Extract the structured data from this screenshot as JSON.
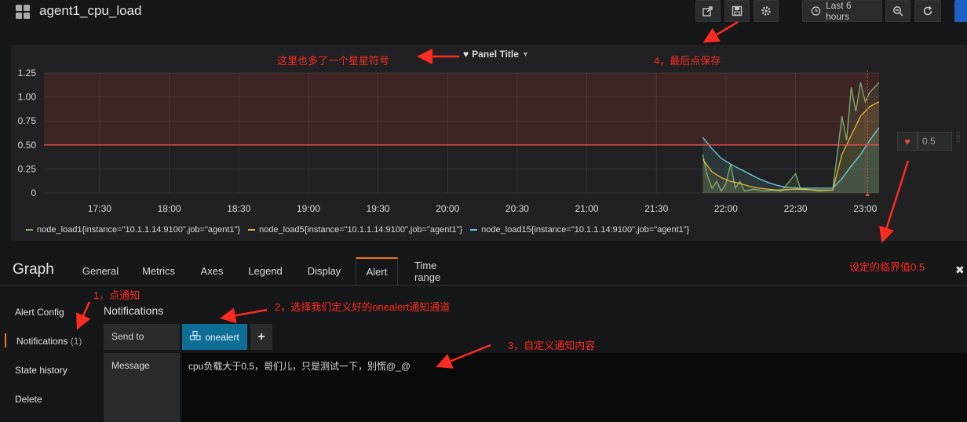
{
  "nav": {
    "dashboard_title": "agent1_cpu_load",
    "time_range_label": "Last 6 hours",
    "icons": [
      "share-icon",
      "save-icon",
      "settings-icon",
      "clock-icon",
      "zoom-out-icon",
      "refresh-icon"
    ]
  },
  "panel": {
    "title": "Panel Title"
  },
  "chart_data": {
    "type": "line",
    "x": [
      "17:30",
      "18:00",
      "18:30",
      "19:00",
      "19:30",
      "20:00",
      "20:30",
      "21:00",
      "21:30",
      "22:00",
      "22:30",
      "23:00"
    ],
    "y_ticks": [
      "1.25",
      "1.00",
      "0.75",
      "0.50",
      "0.25",
      "0"
    ],
    "ylim": [
      0,
      1.25
    ],
    "threshold": 0.5,
    "threshold_color": "#e24d42",
    "series": [
      {
        "name": "node_load1{instance=\"10.1.1.14:9100\",job=\"agent1\"}",
        "color": "#7eb26d",
        "points": [
          [
            "21:50",
            0.4
          ],
          [
            "21:52",
            0.18
          ],
          [
            "21:54",
            0.05
          ],
          [
            "21:56",
            0.12
          ],
          [
            "21:58",
            0.02
          ],
          [
            "22:00",
            0.1
          ],
          [
            "22:02",
            0.3
          ],
          [
            "22:04",
            0.05
          ],
          [
            "22:06",
            0.12
          ],
          [
            "22:08",
            0.02
          ],
          [
            "22:12",
            0.04
          ],
          [
            "22:16",
            0.02
          ],
          [
            "22:20",
            0.03
          ],
          [
            "22:24",
            0.02
          ],
          [
            "22:30",
            0.2
          ],
          [
            "22:32",
            0.05
          ],
          [
            "22:40",
            0.02
          ],
          [
            "22:46",
            0.03
          ],
          [
            "22:50",
            0.8
          ],
          [
            "22:52",
            0.55
          ],
          [
            "22:54",
            1.1
          ],
          [
            "22:56",
            0.85
          ],
          [
            "22:58",
            1.15
          ],
          [
            "23:00",
            0.95
          ],
          [
            "23:02",
            1.05
          ],
          [
            "23:04",
            1.1
          ],
          [
            "23:06",
            1.15
          ]
        ]
      },
      {
        "name": "node_load5{instance=\"10.1.1.14:9100\",job=\"agent1\"}",
        "color": "#eab839",
        "points": [
          [
            "21:50",
            0.35
          ],
          [
            "21:54",
            0.22
          ],
          [
            "21:58",
            0.16
          ],
          [
            "22:02",
            0.12
          ],
          [
            "22:06",
            0.1
          ],
          [
            "22:10",
            0.07
          ],
          [
            "22:14",
            0.05
          ],
          [
            "22:18",
            0.04
          ],
          [
            "22:22",
            0.03
          ],
          [
            "22:30",
            0.04
          ],
          [
            "22:40",
            0.03
          ],
          [
            "22:46",
            0.03
          ],
          [
            "22:50",
            0.4
          ],
          [
            "22:54",
            0.6
          ],
          [
            "22:58",
            0.8
          ],
          [
            "23:02",
            0.9
          ],
          [
            "23:06",
            0.95
          ]
        ]
      },
      {
        "name": "node_load15{instance=\"10.1.1.14:9100\",job=\"agent1\"}",
        "color": "#6ed0e0",
        "points": [
          [
            "21:50",
            0.58
          ],
          [
            "21:54",
            0.46
          ],
          [
            "21:58",
            0.36
          ],
          [
            "22:02",
            0.3
          ],
          [
            "22:06",
            0.25
          ],
          [
            "22:10",
            0.2
          ],
          [
            "22:14",
            0.15
          ],
          [
            "22:18",
            0.11
          ],
          [
            "22:22",
            0.08
          ],
          [
            "22:26",
            0.06
          ],
          [
            "22:32",
            0.05
          ],
          [
            "22:40",
            0.05
          ],
          [
            "22:46",
            0.05
          ],
          [
            "22:50",
            0.15
          ],
          [
            "22:54",
            0.28
          ],
          [
            "22:58",
            0.4
          ],
          [
            "23:02",
            0.55
          ],
          [
            "23:06",
            0.68
          ]
        ]
      }
    ]
  },
  "threshold_input": "0.5",
  "editor": {
    "title": "Graph",
    "tabs": [
      "General",
      "Metrics",
      "Axes",
      "Legend",
      "Display",
      "Alert",
      "Time range"
    ],
    "active_tab": "Alert"
  },
  "alert_menu": {
    "items": [
      "Alert Config",
      "Notifications",
      "State history",
      "Delete"
    ],
    "notifications_count": "(1)"
  },
  "notifications": {
    "heading": "Notifications",
    "send_to_label": "Send to",
    "channel": "onealert",
    "message_label": "Message",
    "message": "cpu负载大于0.5，哥们儿，只是测试一下，别慌@_@"
  },
  "annotations": {
    "star_note": "这里也多了一个星星符号",
    "step1": "1，点通知",
    "step2": "2，选择我们定义好的onealert通知通道",
    "step3": "3，自定义通知内容",
    "step4": "4，最后点保存",
    "threshold_note": "设定的临界值0.5"
  }
}
